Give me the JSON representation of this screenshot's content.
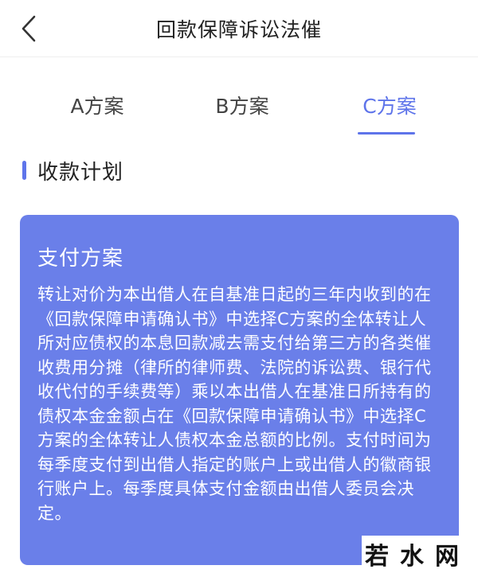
{
  "header": {
    "title": "回款保障诉讼法催",
    "back_icon": "chevron-left-icon"
  },
  "tabs": [
    {
      "label": "A方案",
      "selected": false
    },
    {
      "label": "B方案",
      "selected": false
    },
    {
      "label": "C方案",
      "selected": true
    }
  ],
  "section": {
    "title": "收款计划"
  },
  "card": {
    "title": "支付方案",
    "body": "转让对价为本出借人在自基准日起的三年内收到的在《回款保障申请确认书》中选择C方案的全体转让人所对应债权的本息回款减去需支付给第三方的各类催收费用分摊（律所的律师费、法院的诉讼费、银行代收代付的手续费等）乘以本出借人在基准日所持有的债权本金金额占在《回款保障申请确认书》中选择C方案的全体转让人债权本金总额的比例。支付时间为每季度支付到出借人指定的账户上或出借人的徽商银行账户上。每季度具体支付金额由出借人委员会决定。"
  },
  "watermark": {
    "text": "若水网"
  },
  "colors": {
    "accent": "#5e74ea",
    "card_bg": "#6a7fe9",
    "text_primary": "#222222",
    "card_text": "#ffffff"
  }
}
